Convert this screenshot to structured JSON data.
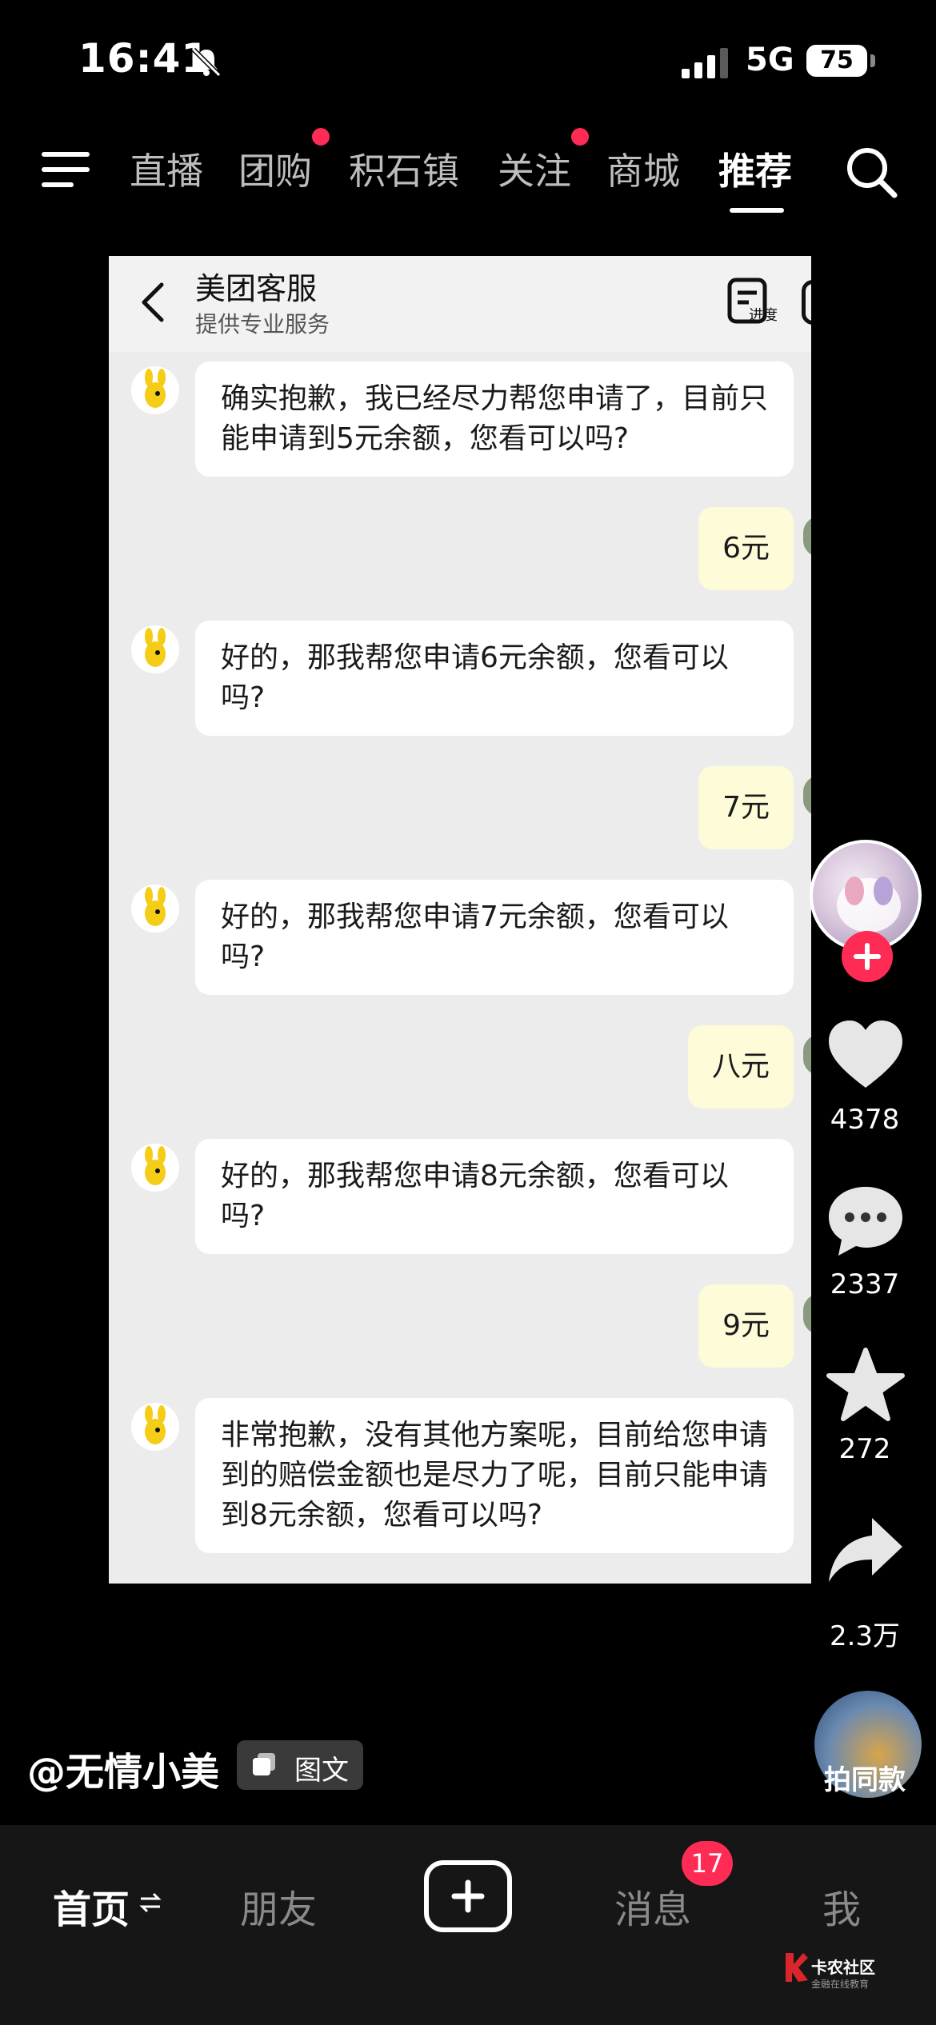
{
  "status_bar": {
    "time": "16:41",
    "network": "5G",
    "battery": "75"
  },
  "top_nav": {
    "tabs": [
      {
        "label": "直播",
        "dot": false
      },
      {
        "label": "团购",
        "dot": true
      },
      {
        "label": "积石镇",
        "dot": false
      },
      {
        "label": "关注",
        "dot": true
      },
      {
        "label": "商城",
        "dot": false
      },
      {
        "label": "推荐",
        "dot": false,
        "active": true
      }
    ]
  },
  "chat": {
    "title": "美团客服",
    "subtitle": "提供专业服务",
    "progress_label": "进度",
    "messages": [
      {
        "side": "in",
        "text": "确实抱歉，我已经尽力帮您申请了，目前只能申请到5元余额，您看可以吗?"
      },
      {
        "side": "out",
        "text": "6元"
      },
      {
        "side": "in",
        "text": "好的，那我帮您申请6元余额，您看可以吗?"
      },
      {
        "side": "out",
        "text": "7元"
      },
      {
        "side": "in",
        "text": "好的，那我帮您申请7元余额，您看可以吗?"
      },
      {
        "side": "out",
        "text": "八元"
      },
      {
        "side": "in",
        "text": "好的，那我帮您申请8元余额，您看可以吗?"
      },
      {
        "side": "out",
        "text": "9元"
      },
      {
        "side": "in",
        "text": "非常抱歉，没有其他方案呢，目前给您申请到的赔偿金额也是尽力了呢，目前只能申请到8元余额，您看可以吗?"
      }
    ]
  },
  "rail": {
    "likes": "4378",
    "comments": "2337",
    "favorites": "272",
    "shares": "2.3万",
    "same_style_label": "拍同款"
  },
  "post": {
    "author": "@无情小美",
    "tag": "图文"
  },
  "bottom_nav": {
    "home": "首页",
    "friends": "朋友",
    "messages": "消息",
    "messages_badge": "17",
    "me": "我"
  },
  "watermark": {
    "line1": "卡农社区",
    "line2": "金融在线教育"
  },
  "colors": {
    "accent": "#fe2c55",
    "bubble_out": "#fdfbd8",
    "bubble_in": "#ffffff"
  }
}
